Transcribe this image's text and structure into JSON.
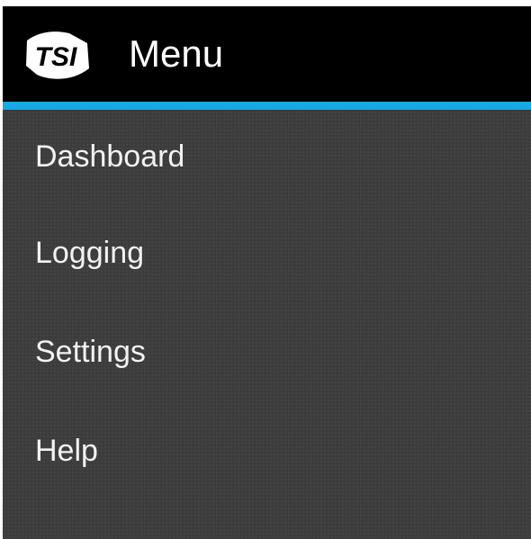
{
  "colors": {
    "header_bg": "#000000",
    "accent": "#17a9e1",
    "menu_bg": "#3c3c3c",
    "text": "#ffffff"
  },
  "header": {
    "logo_icon": "tsi-logo-icon",
    "title": "Menu"
  },
  "menu": {
    "items": [
      {
        "label": "Dashboard"
      },
      {
        "label": "Logging"
      },
      {
        "label": "Settings"
      },
      {
        "label": "Help"
      }
    ]
  }
}
